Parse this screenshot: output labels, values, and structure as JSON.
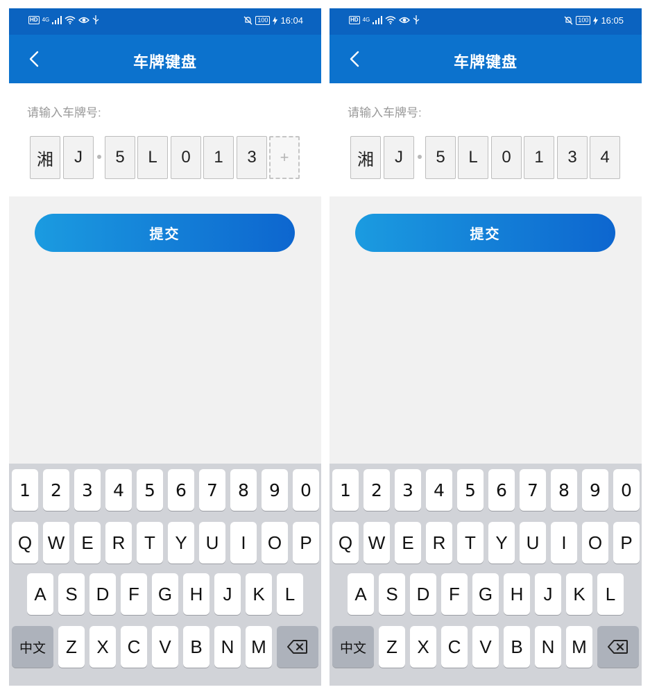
{
  "screens": [
    {
      "status": {
        "network": "4G",
        "battery": "100",
        "time": "16:04"
      },
      "header": {
        "title": "车牌键盘"
      },
      "prompt": "请输入车牌号:",
      "plate_chars": [
        "湘",
        "J",
        "5",
        "L",
        "0",
        "1",
        "3",
        "+"
      ],
      "submit_label": "提交"
    },
    {
      "status": {
        "network": "4G",
        "battery": "100",
        "time": "16:05"
      },
      "header": {
        "title": "车牌键盘"
      },
      "prompt": "请输入车牌号:",
      "plate_chars": [
        "湘",
        "J",
        "5",
        "L",
        "0",
        "1",
        "3",
        "4"
      ],
      "submit_label": "提交"
    }
  ],
  "keyboard": {
    "row1": [
      "1",
      "2",
      "3",
      "4",
      "5",
      "6",
      "7",
      "8",
      "9",
      "0"
    ],
    "row2": [
      "Q",
      "W",
      "E",
      "R",
      "T",
      "Y",
      "U",
      "I",
      "O",
      "P"
    ],
    "row3": [
      "A",
      "S",
      "D",
      "F",
      "G",
      "H",
      "J",
      "K",
      "L"
    ],
    "row4": [
      "Z",
      "X",
      "C",
      "V",
      "B",
      "N",
      "M"
    ],
    "switch_label": "中文"
  }
}
